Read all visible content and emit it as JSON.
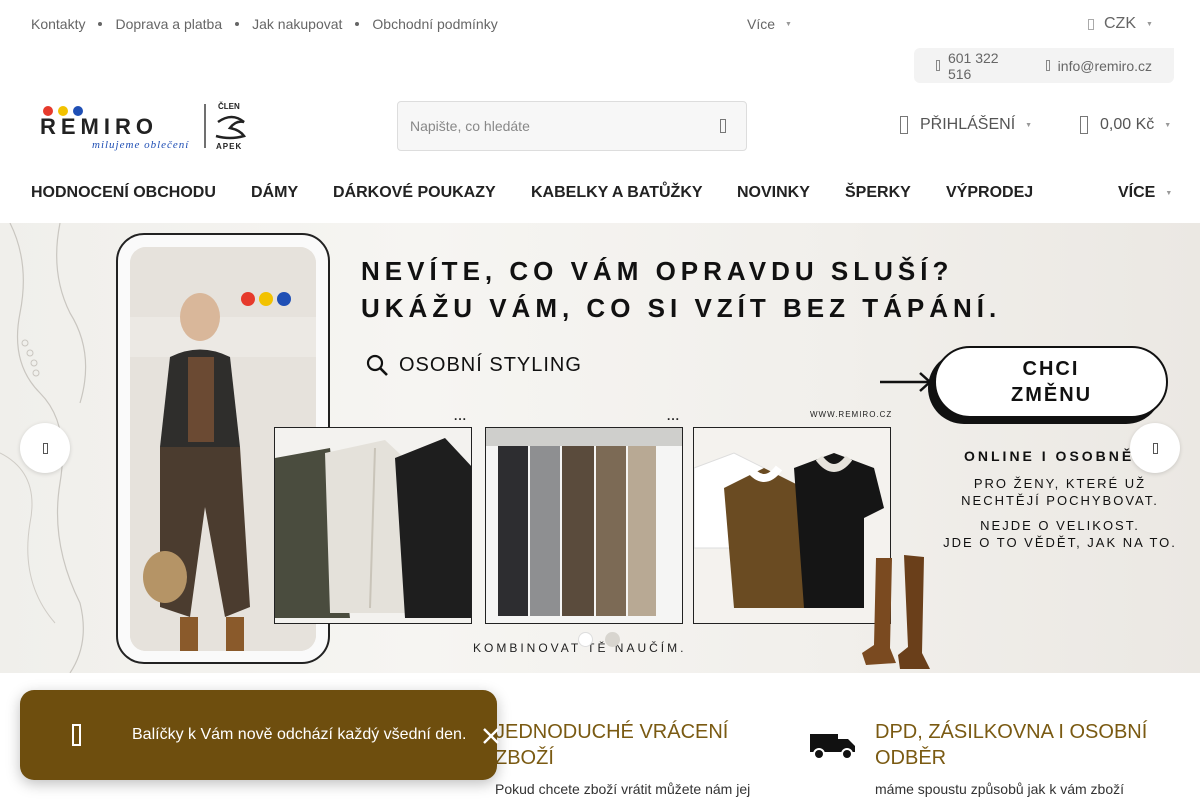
{
  "topbar": {
    "links": [
      "Kontakty",
      "Doprava a platba",
      "Jak nakupovat",
      "Obchodní podmínky"
    ],
    "more_label": "Více",
    "currency": "CZK",
    "phone": "601 322 516",
    "email": "info@remiro.cz"
  },
  "header": {
    "logo": {
      "brand": "REMIRO",
      "tagline": "milujeme oblečení",
      "member_label": "ČLEN",
      "member_org": "APEK",
      "dot_colors": [
        "#e63a2c",
        "#f2c200",
        "#1f4fb5"
      ]
    },
    "search_placeholder": "Napište, co hledáte",
    "login_label": "PŘIHLÁŠENÍ",
    "cart_total": "0,00 Kč"
  },
  "nav": {
    "items": [
      "HODNOCENÍ OBCHODU",
      "DÁMY",
      "DÁRKOVÉ POUKAZY",
      "KABELKY A BATŮŽKY",
      "NOVINKY",
      "ŠPERKY",
      "VÝPRODEJ"
    ],
    "more_label": "VÍCE"
  },
  "banner": {
    "heading_line1": "NEVÍTE, CO VÁM OPRAVDU SLUŠÍ?",
    "heading_line2": "UKÁŽU VÁM, CO SI VZÍT BEZ TÁPÁNÍ.",
    "styling_label": "OSOBNÍ STYLING",
    "cta_label": "CHCI ZMĚNU",
    "url": "WWW.REMIRO.CZ",
    "online_label": "ONLINE I OSOBNĚ",
    "copy_line1": "PRO ŽENY, KTERÉ UŽ",
    "copy_line2": "NECHTĚJÍ POCHYBOVAT.",
    "copy_line3": "NEJDE O VELIKOST.",
    "copy_line4": "JDE O TO VĚDĚT, JAK NA TO.",
    "bottom_text": "KOMBINOVAT TĚ NAUČÍM.",
    "ellipsis": "...",
    "slide_count": 2,
    "active_slide": 1
  },
  "benefits": [
    {
      "title": "JEDNODUCHÉ VRÁCENÍ ZBOŽÍ",
      "text": "Pokud chcete zboží vrátit můžete nám jej"
    },
    {
      "title": "DPD, ZÁSILKOVNA I OSOBNÍ ODBĚR",
      "text": "máme spoustu způsobů jak k vám zboží"
    }
  ],
  "toast": {
    "message": "Balíčky k Vám nově odchází každý všední den."
  },
  "colors": {
    "accent": "#7a5a12",
    "toast_bg": "#6e4e0e",
    "nav_text": "#222222",
    "top_text": "#666666"
  },
  "icons": [
    "phone-icon",
    "email-icon",
    "currency-icon",
    "search-icon",
    "user-icon",
    "cart-icon",
    "truck-icon",
    "bell-icon",
    "close-icon",
    "chevron-left-icon",
    "chevron-right-icon",
    "magnifier-icon"
  ]
}
